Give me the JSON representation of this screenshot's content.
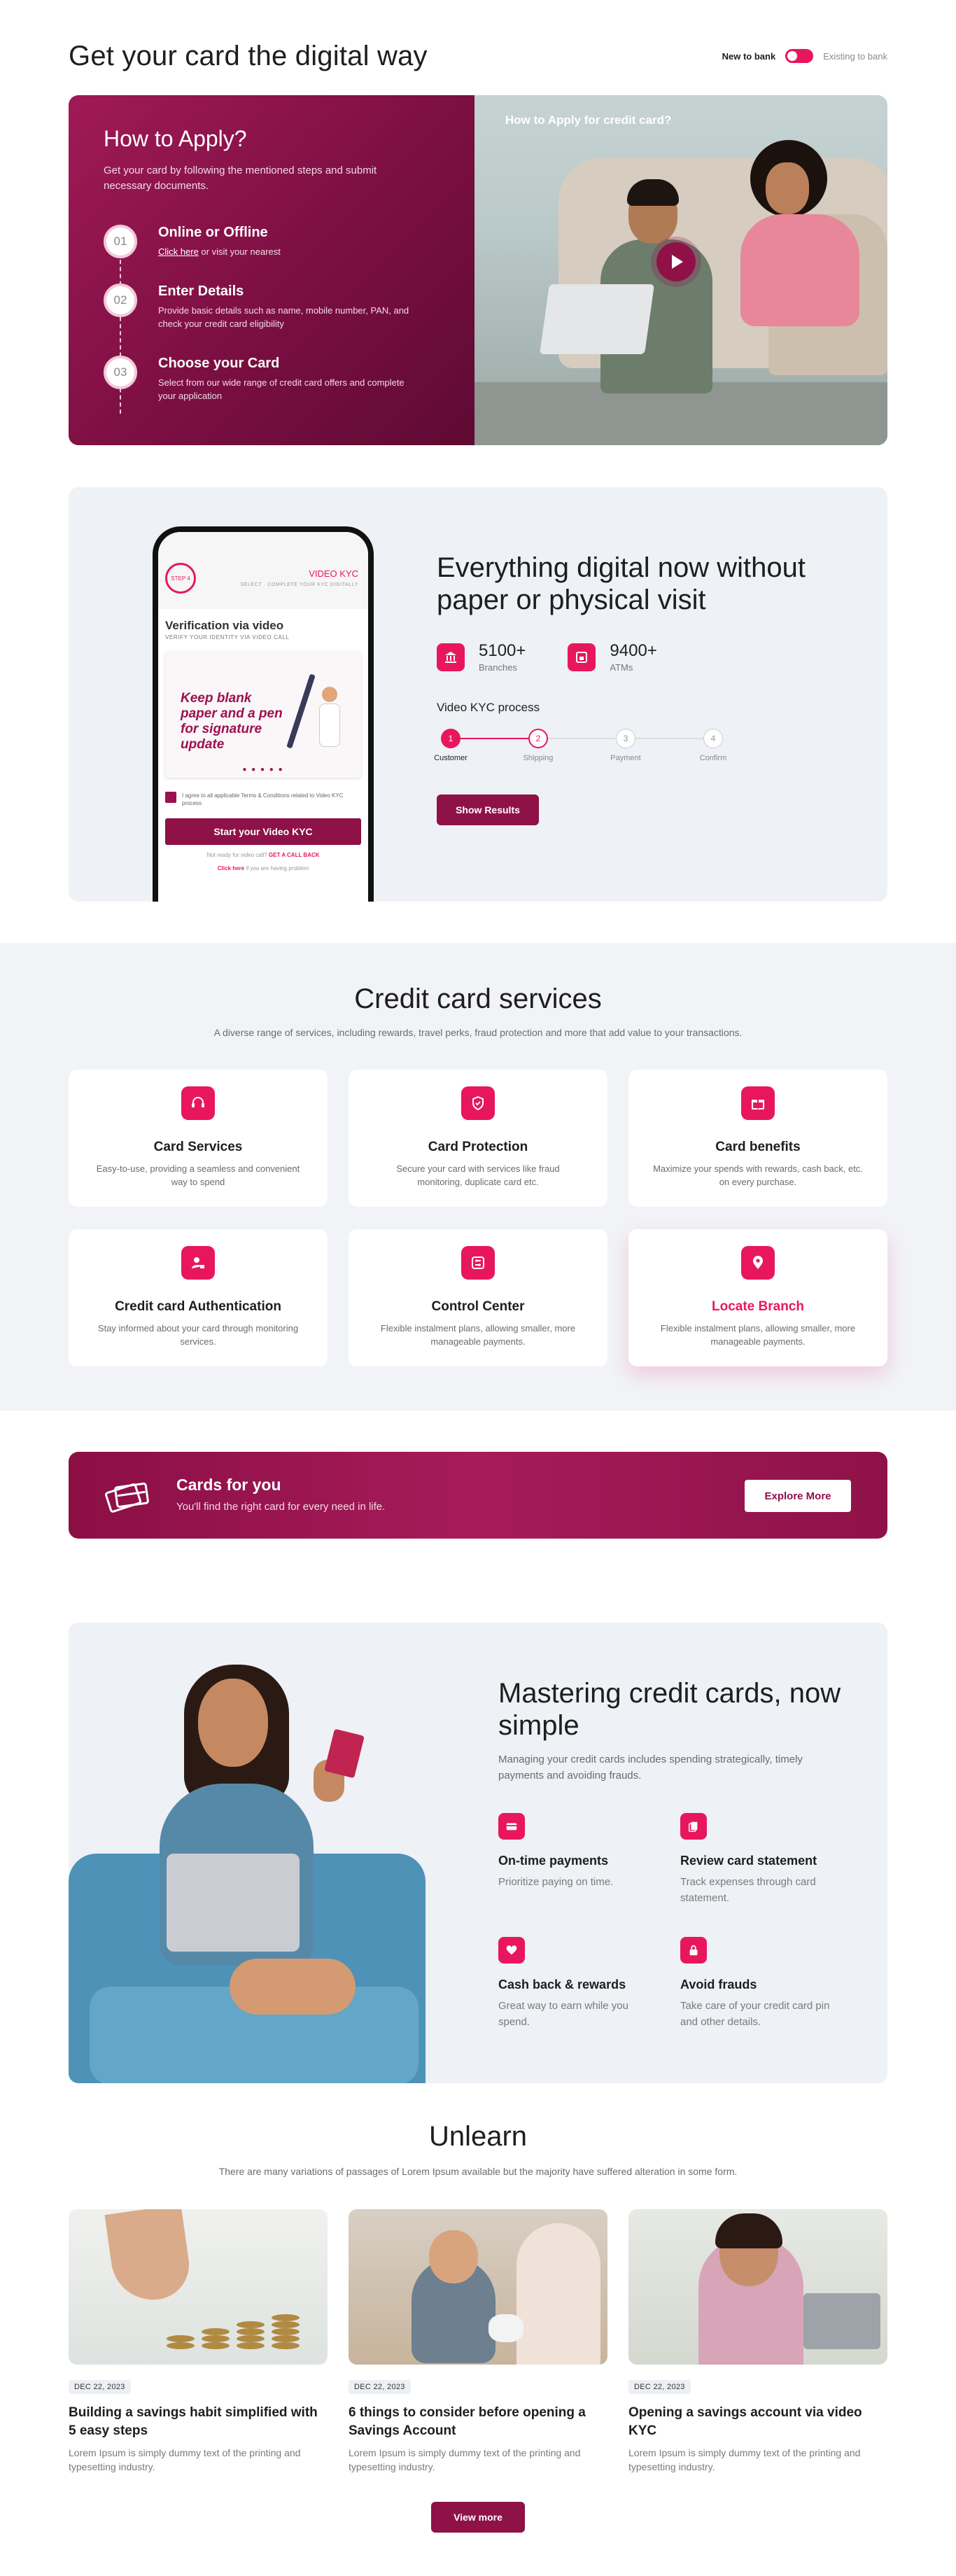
{
  "header": {
    "title": "Get your card the digital way",
    "toggle_on_label": "New to bank",
    "toggle_off_label": "Existing to bank"
  },
  "apply": {
    "title": "How to Apply?",
    "subtitle": "Get your card by following the mentioned steps and submit necessary documents.",
    "video_title": "How to Apply for credit card?",
    "steps": [
      {
        "num": "01",
        "title": "Online or Offline",
        "link": "Click here",
        "desc": " or visit your nearest"
      },
      {
        "num": "02",
        "title": "Enter Details",
        "desc": "Provide basic details such as name, mobile number, PAN, and check your credit card eligibility"
      },
      {
        "num": "03",
        "title": "Choose your Card",
        "desc": "Select from our wide range of credit card offers and complete your application"
      }
    ]
  },
  "digital": {
    "title": "Everything digital now without paper or physical visit",
    "stats": [
      {
        "icon": "bank-icon",
        "value": "5100+",
        "label": "Branches"
      },
      {
        "icon": "atm-icon",
        "value": "9400+",
        "label": "ATMs"
      }
    ],
    "kyc_title": "Video KYC process",
    "kyc_steps": [
      {
        "num": "1",
        "label": "Customer",
        "state": "done"
      },
      {
        "num": "2",
        "label": "Shipping",
        "state": "current"
      },
      {
        "num": "3",
        "label": "Payment",
        "state": "todo"
      },
      {
        "num": "4",
        "label": "Confirm",
        "state": "todo"
      }
    ],
    "button": "Show Results",
    "phone": {
      "logo": "STEP 4",
      "brand": "VIDEO KYC",
      "brand_sub": "SELECT · COMPLETE YOUR KYC DIGITALLY",
      "title": "Verification via video",
      "subtitle": "VERIFY YOUR IDENTITY VIA VIDEO CALL",
      "card_text": "Keep blank paper and a pen for signature update",
      "dots": "● ● ● ● ●",
      "consent": "I agree to all applicable Terms & Conditions related to Video KYC process",
      "cta": "Start your Video KYC",
      "foot_text": "Not ready for video call?",
      "foot_link": "GET A CALL BACK",
      "foot2_link": "Click here",
      "foot2_text": " if you are having problem"
    }
  },
  "services": {
    "title": "Credit card services",
    "subtitle": "A diverse range of services, including rewards, travel perks,  fraud protection and more that add value to your transactions.",
    "items": [
      {
        "icon": "headset-icon",
        "title": "Card Services",
        "desc": "Easy-to-use, providing a seamless and convenient way to spend"
      },
      {
        "icon": "shield-icon",
        "title": "Card Protection",
        "desc": "Secure your card with services like fraud monitoring, duplicate card etc."
      },
      {
        "icon": "gift-icon",
        "title": "Card benefits",
        "desc": "Maximize your spends with rewards, cash back, etc. on every purchase."
      },
      {
        "icon": "user-lock-icon",
        "title": "Credit card Authentication",
        "desc": "Stay informed about your card through monitoring services."
      },
      {
        "icon": "sliders-icon",
        "title": "Control Center",
        "desc": "Flexible instalment plans, allowing smaller, more manageable payments."
      },
      {
        "icon": "location-pin-icon",
        "title": "Locate Branch",
        "desc": "Flexible instalment plans, allowing smaller, more manageable payments."
      }
    ],
    "accent": "#e8175d"
  },
  "banner": {
    "title": "Cards for you",
    "subtitle": "You'll find the right card for every need in life.",
    "button": "Explore More"
  },
  "master": {
    "title": "Mastering credit cards, now simple",
    "subtitle": "Managing your credit cards includes spending strategically, timely payments and avoiding frauds.",
    "tips": [
      {
        "icon": "card-icon",
        "title": "On-time payments",
        "desc": "Prioritize paying on time."
      },
      {
        "icon": "document-icon",
        "title": "Review card statement",
        "desc": "Track expenses through card statement."
      },
      {
        "icon": "heart-icon",
        "title": "Cash back & rewards",
        "desc": "Great way to earn while you spend."
      },
      {
        "icon": "lock-icon",
        "title": "Avoid frauds",
        "desc": "Take care of your credit card pin and other details."
      }
    ]
  },
  "unlearn": {
    "title": "Unlearn",
    "subtitle": "There are many variations of passages of Lorem Ipsum available but the majority have suffered alteration in some form.",
    "posts": [
      {
        "date": "DEC 22, 2023",
        "title": "Building a savings habit simplified with 5 easy steps",
        "desc": "Lorem Ipsum is simply dummy text of the printing and typesetting industry."
      },
      {
        "date": "DEC 22, 2023",
        "title": "6 things to consider before opening a Savings Account",
        "desc": "Lorem Ipsum is simply dummy text of the printing and typesetting industry."
      },
      {
        "date": "DEC 22, 2023",
        "title": "Opening a savings account via video KYC",
        "desc": "Lorem Ipsum is simply dummy text of the printing and typesetting industry."
      }
    ],
    "button": "View more"
  },
  "colors": {
    "brand_primary": "#8e1148",
    "brand_accent": "#e8175d",
    "section_bg": "#eef1f5"
  }
}
